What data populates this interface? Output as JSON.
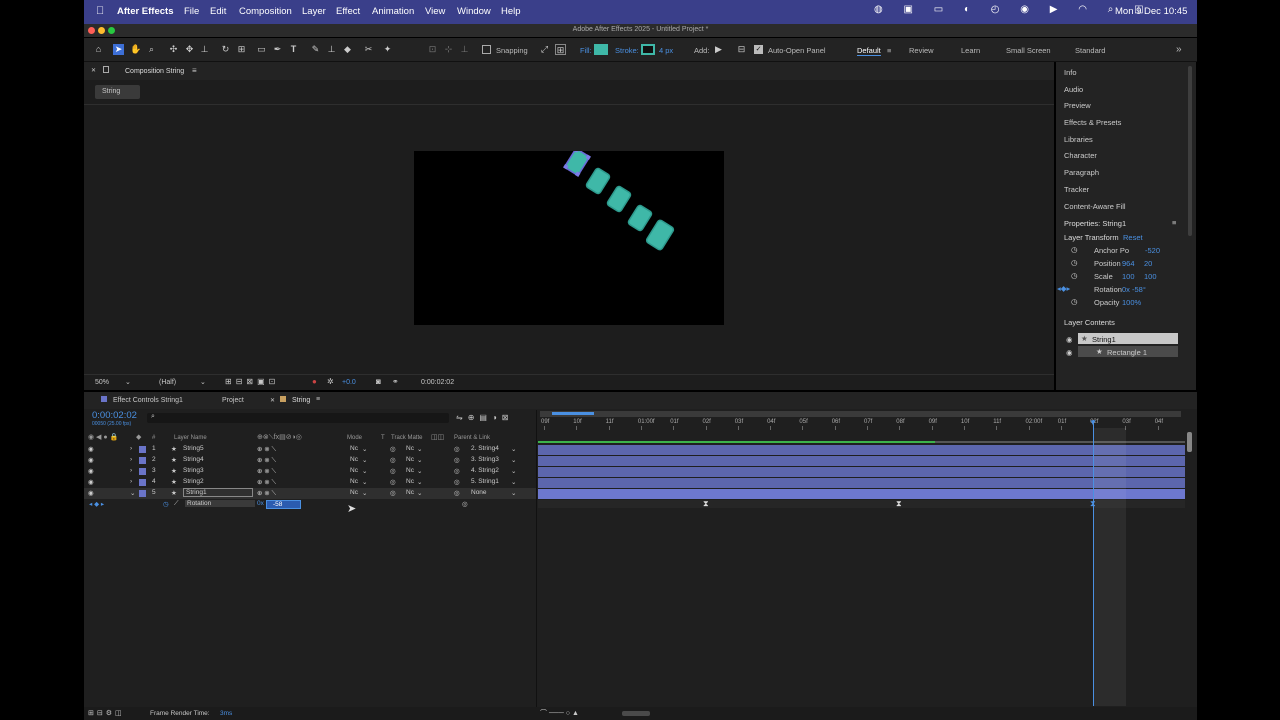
{
  "menubar": {
    "app": "After Effects",
    "items": [
      "File",
      "Edit",
      "Composition",
      "Layer",
      "Effect",
      "Animation",
      "View",
      "Window",
      "Help"
    ],
    "datetime": "Mon 9 Dec  10:45"
  },
  "titlebar": {
    "title": "Adobe After Effects 2025 - Untitled Project *"
  },
  "toolbar": {
    "snapping": "Snapping",
    "fill": "Fill:",
    "stroke": "Stroke:",
    "stroke_px": "4 px",
    "add": "Add:",
    "auto_open": "Auto-Open Panel",
    "workspaces": [
      "Default",
      "Review",
      "Learn",
      "Small Screen",
      "Standard"
    ],
    "fill_color": "#3fb8a8",
    "stroke_color": "#2d9a8d"
  },
  "comp": {
    "tab": "Composition String",
    "sub_tab": "String",
    "zoom": "50%",
    "resolution": "(Half)",
    "exposure": "+0.0",
    "timecode": "0:00:02:02"
  },
  "right_panel": {
    "items": [
      "Info",
      "Audio",
      "Preview",
      "Effects & Presets",
      "Libraries",
      "Character",
      "Paragraph",
      "Tracker",
      "Content-Aware Fill"
    ],
    "properties_title": "Properties: String1",
    "layer_transform": "Layer Transform",
    "reset": "Reset",
    "anchor_label": "Anchor Po",
    "anchor_value": "-520",
    "position_label": "Position",
    "position_x": "964",
    "position_y": "20",
    "scale_label": "Scale",
    "scale_x": "100",
    "scale_y": "100",
    "rotation_label": "Rotation",
    "rotation_value": "0x -58°",
    "opacity_label": "Opacity",
    "opacity_value": "100%",
    "layer_contents": "Layer Contents",
    "contents": [
      "String1",
      "Rectangle 1"
    ]
  },
  "timeline": {
    "tabs": [
      "Effect Controls String1",
      "Project",
      "String"
    ],
    "timecode": "0:00:02:02",
    "fps": "00050 (25.00 fps)",
    "search_placeholder": "",
    "col_headers": {
      "layer_name": "Layer Name",
      "mode": "Mode",
      "t": "T",
      "track_matte": "Track Matte",
      "parent": "Parent & Link",
      "hash": "#"
    },
    "layers": [
      {
        "num": "1",
        "name": "String5",
        "mode": "Nc",
        "matte": "Nc",
        "parent": "2. String4"
      },
      {
        "num": "2",
        "name": "String4",
        "mode": "Nc",
        "matte": "Nc",
        "parent": "3. String3"
      },
      {
        "num": "3",
        "name": "String3",
        "mode": "Nc",
        "matte": "Nc",
        "parent": "4. String2"
      },
      {
        "num": "4",
        "name": "String2",
        "mode": "Nc",
        "matte": "Nc",
        "parent": "5. String1"
      },
      {
        "num": "5",
        "name": "String1",
        "mode": "Nc",
        "matte": "Nc",
        "parent": "None"
      }
    ],
    "rotation_label": "Rotation",
    "rotation_prefix": "0x",
    "rotation_input": "-58",
    "ruler": [
      "09f",
      "10f",
      "11f",
      "01:00f",
      "01f",
      "02f",
      "03f",
      "04f",
      "05f",
      "06f",
      "07f",
      "08f",
      "09f",
      "10f",
      "11f",
      "02:00f",
      "01f",
      "02f",
      "03f",
      "04f"
    ],
    "frame_render_label": "Frame Render Time:",
    "frame_render_value": "3ms"
  }
}
